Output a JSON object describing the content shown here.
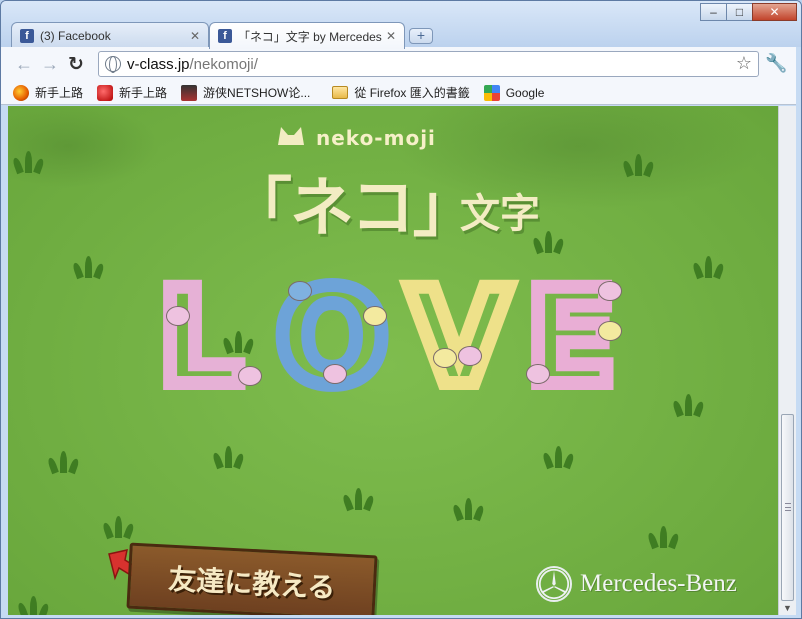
{
  "tabs": [
    {
      "label": "(3) Facebook",
      "favicon": "facebook-icon",
      "active": false
    },
    {
      "label": "「ネコ」文字 by Mercedes",
      "favicon": "facebook-icon",
      "active": true
    }
  ],
  "window_controls": {
    "minimize": "–",
    "maximize": "□",
    "close": "✕"
  },
  "toolbar": {
    "url_host": "v-class.jp",
    "url_path": "/nekomoji/"
  },
  "bookmarks": [
    {
      "label": "新手上路",
      "icon": "firefox-icon"
    },
    {
      "label": "新手上路",
      "icon": "red-app-icon"
    },
    {
      "label": "游侠NETSHOW论...",
      "icon": "netshow-icon"
    },
    {
      "label": "從 Firefox 匯入的書籤",
      "icon": "folder-icon"
    },
    {
      "label": "Google",
      "icon": "google-icon"
    }
  ],
  "page": {
    "logo_small": "neko-moji",
    "logo_main": "「ネコ」",
    "logo_sub": "文字",
    "love_letters": [
      "L",
      "O",
      "V",
      "E"
    ],
    "share_button": "友達に教える",
    "brand": "Mercedes-Benz"
  },
  "colors": {
    "grass_green": "#6aa83d",
    "logo_cream": "#f3ecc3",
    "wood": "#6e4020"
  }
}
